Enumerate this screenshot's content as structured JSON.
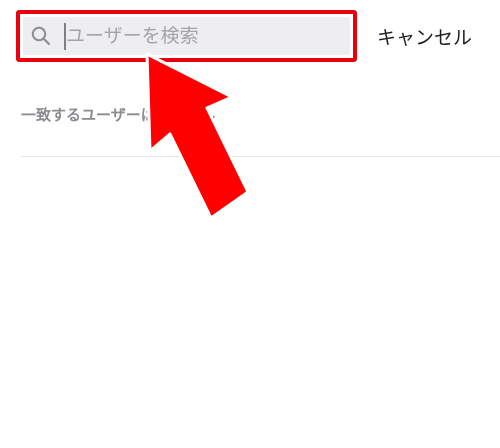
{
  "search": {
    "placeholder": "ユーザーを検索",
    "value": "",
    "icon": "search-icon"
  },
  "header": {
    "cancel_label": "キャンセル"
  },
  "results": {
    "empty_message": "一致するユーザーはいません"
  },
  "annotation": {
    "highlight_color": "#e8000f",
    "arrow_color": "#ff0000"
  }
}
